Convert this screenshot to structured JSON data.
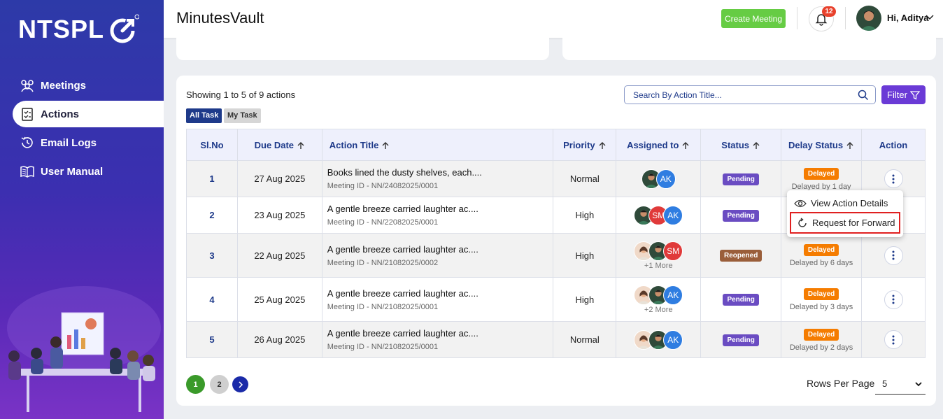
{
  "brand": {
    "logo_text": "NTSPL",
    "app_title": "MinutesVault"
  },
  "sidebar": {
    "items": [
      {
        "label": "Meetings",
        "icon": "meetings-icon"
      },
      {
        "label": "Actions",
        "icon": "checklist-icon",
        "active": true
      },
      {
        "label": "Email Logs",
        "icon": "history-icon"
      },
      {
        "label": "User Manual",
        "icon": "book-icon"
      }
    ]
  },
  "header": {
    "create_label": "Create Meeting",
    "notification_count": "12",
    "greeting": "Hi, Aditya"
  },
  "actions": {
    "showing": "Showing 1 to 5 of 9 actions",
    "tabs": {
      "all": "All Task",
      "my": "My Task"
    },
    "search_placeholder": "Search By Action Title...",
    "filter_label": "Filter",
    "columns": [
      "Sl.No",
      "Due Date",
      "Action Title",
      "Priority",
      "Assigned to",
      "Status",
      "Delay Status",
      "Action"
    ],
    "rows": [
      {
        "slno": "1",
        "due": "27 Aug 2025",
        "title": "Books lined the dusty shelves, each....",
        "meeting": "Meeting ID - NN/24082025/0001",
        "priority": "Normal",
        "assignees": [
          "photo",
          "AK"
        ],
        "more": "",
        "status": "Pending",
        "delay_badge": "Delayed",
        "delay_text": "Delayed by 1 day"
      },
      {
        "slno": "2",
        "due": "23 Aug 2025",
        "title": "A gentle breeze carried laughter ac....",
        "meeting": "Meeting ID - NN/22082025/0001",
        "priority": "High",
        "assignees": [
          "photo",
          "SM",
          "AK"
        ],
        "more": "",
        "status": "Pending",
        "delay_badge": "",
        "delay_text": ""
      },
      {
        "slno": "3",
        "due": "22 Aug 2025",
        "title": "A gentle breeze carried laughter ac....",
        "meeting": "Meeting ID - NN/21082025/0002",
        "priority": "High",
        "assignees": [
          "female",
          "photo",
          "SM"
        ],
        "more": "+1 More",
        "status": "Reopened",
        "delay_badge": "Delayed",
        "delay_text": "Delayed by 6 days"
      },
      {
        "slno": "4",
        "due": "25 Aug 2025",
        "title": "A gentle breeze carried laughter ac....",
        "meeting": "Meeting ID - NN/21082025/0001",
        "priority": "High",
        "assignees": [
          "female",
          "photo",
          "AK"
        ],
        "more": "+2 More",
        "status": "Pending",
        "delay_badge": "Delayed",
        "delay_text": "Delayed by 3 days"
      },
      {
        "slno": "5",
        "due": "26 Aug 2025",
        "title": "A gentle breeze carried laughter ac....",
        "meeting": "Meeting ID - NN/21082025/0001",
        "priority": "Normal",
        "assignees": [
          "female",
          "photo",
          "AK"
        ],
        "more": "",
        "status": "Pending",
        "delay_badge": "Delayed",
        "delay_text": "Delayed by 2 days"
      }
    ],
    "menu": {
      "view": "View Action Details",
      "forward": "Request for Forward"
    },
    "pagination": {
      "pages": [
        "1",
        "2"
      ],
      "rows_per_page_label": "Rows Per Page",
      "rows_per_page_value": "5"
    }
  },
  "colors": {
    "accent": "#6a3ad6",
    "primary": "#1e3a8a",
    "create": "#66cc44",
    "delayed": "#f57c00",
    "pending": "#6a4cc2",
    "reopened": "#9a5e3a"
  }
}
